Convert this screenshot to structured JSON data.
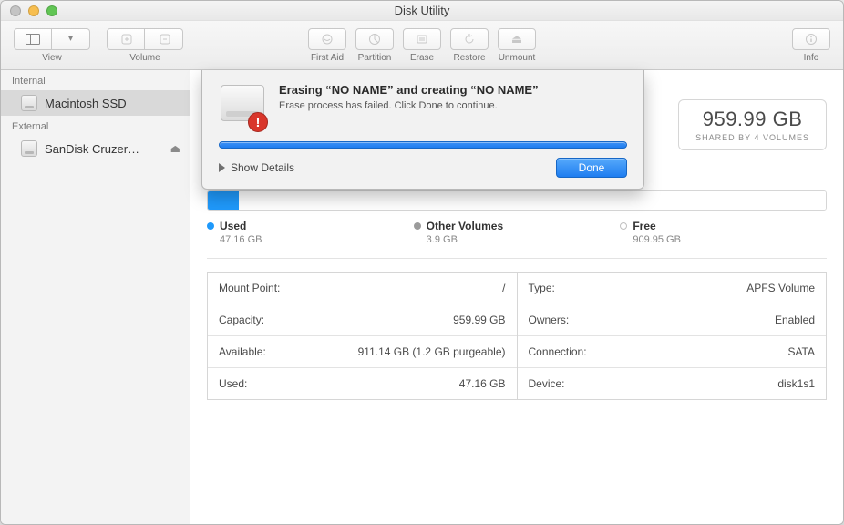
{
  "window": {
    "title": "Disk Utility"
  },
  "toolbar": {
    "view_label": "View",
    "volume_label": "Volume",
    "firstaid_label": "First Aid",
    "partition_label": "Partition",
    "erase_label": "Erase",
    "restore_label": "Restore",
    "unmount_label": "Unmount",
    "info_label": "Info"
  },
  "sidebar": {
    "section_internal": "Internal",
    "section_external": "External",
    "items": [
      {
        "label": "Macintosh SSD"
      },
      {
        "label": "SanDisk Cruzer…"
      }
    ],
    "eject_glyph": "⏏"
  },
  "capacity_box": {
    "value": "959.99 GB",
    "subtitle": "SHARED BY 4 VOLUMES"
  },
  "legend": {
    "used_label": "Used",
    "used_value": "47.16 GB",
    "other_label": "Other Volumes",
    "other_value": "3.9 GB",
    "free_label": "Free",
    "free_value": "909.95 GB"
  },
  "info_left": [
    {
      "k": "Mount Point:",
      "v": "/"
    },
    {
      "k": "Capacity:",
      "v": "959.99 GB"
    },
    {
      "k": "Available:",
      "v": "911.14 GB (1.2 GB purgeable)"
    },
    {
      "k": "Used:",
      "v": "47.16 GB"
    }
  ],
  "info_right": [
    {
      "k": "Type:",
      "v": "APFS Volume"
    },
    {
      "k": "Owners:",
      "v": "Enabled"
    },
    {
      "k": "Connection:",
      "v": "SATA"
    },
    {
      "k": "Device:",
      "v": "disk1s1"
    }
  ],
  "sheet": {
    "heading": "Erasing “NO NAME” and creating “NO NAME”",
    "subtext": "Erase process has failed. Click Done to continue.",
    "show_details": "Show Details",
    "done": "Done",
    "error_glyph": "!"
  }
}
